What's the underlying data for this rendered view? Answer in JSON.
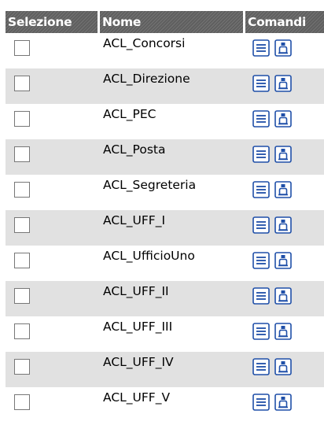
{
  "table": {
    "headers": {
      "selection": "Selezione",
      "name": "Nome",
      "commands": "Comandi"
    },
    "rows": [
      {
        "name": "ACL_Concorsi",
        "selected": false
      },
      {
        "name": "ACL_Direzione",
        "selected": false
      },
      {
        "name": "ACL_PEC",
        "selected": false
      },
      {
        "name": "ACL_Posta",
        "selected": false
      },
      {
        "name": "ACL_Segreteria",
        "selected": false
      },
      {
        "name": "ACL_UFF_I",
        "selected": false
      },
      {
        "name": "ACL_UfficioUno",
        "selected": false
      },
      {
        "name": "ACL_UFF_II",
        "selected": false
      },
      {
        "name": "ACL_UFF_III",
        "selected": false
      },
      {
        "name": "ACL_UFF_IV",
        "selected": false
      },
      {
        "name": "ACL_UFF_V",
        "selected": false
      }
    ]
  },
  "icons": {
    "details": "list-details-icon",
    "permissions": "user-lock-icon"
  },
  "colors": {
    "header_bg": "#5f5f5f",
    "header_text": "#ffffff",
    "row_alt_bg": "#e1e1e1",
    "icon_blue": "#1f4fa8"
  }
}
